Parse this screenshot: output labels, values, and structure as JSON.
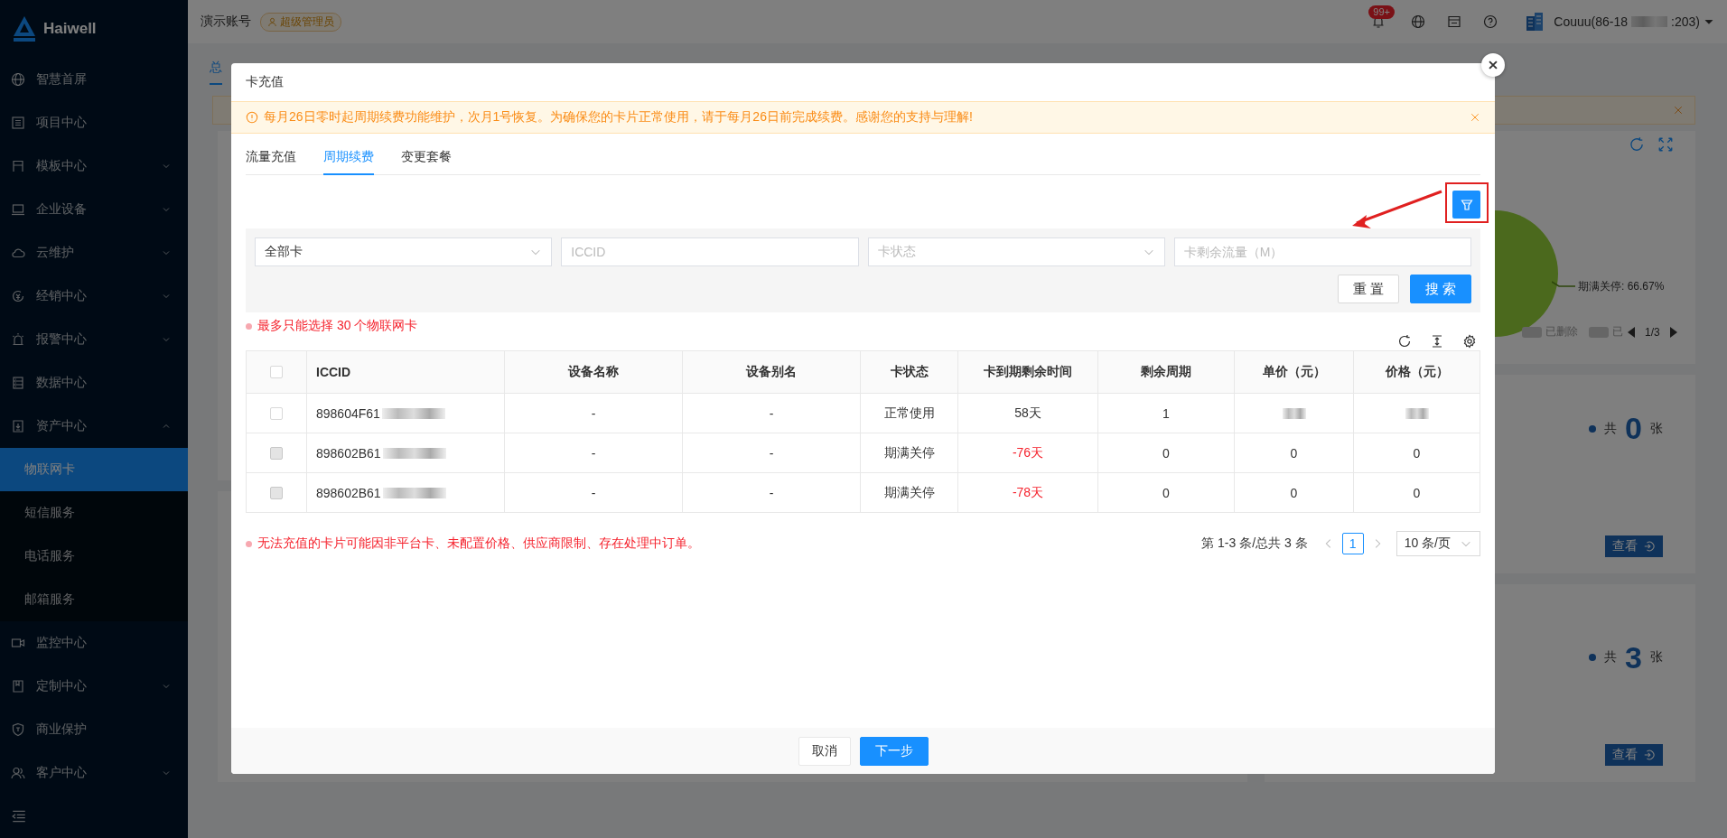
{
  "sidebar": {
    "brand": "Haiwell",
    "items": [
      {
        "label": "智慧首屏",
        "kind": "link"
      },
      {
        "label": "项目中心",
        "kind": "link"
      },
      {
        "label": "模板中心",
        "kind": "group",
        "expanded": false
      },
      {
        "label": "企业设备",
        "kind": "group",
        "expanded": false
      },
      {
        "label": "云维护",
        "kind": "group",
        "expanded": false
      },
      {
        "label": "经销中心",
        "kind": "group",
        "expanded": false
      },
      {
        "label": "报警中心",
        "kind": "group",
        "expanded": false
      },
      {
        "label": "数据中心",
        "kind": "link"
      },
      {
        "label": "资产中心",
        "kind": "group",
        "expanded": true,
        "children": [
          {
            "label": "物联网卡",
            "selected": true
          },
          {
            "label": "短信服务",
            "selected": false
          },
          {
            "label": "电话服务",
            "selected": false
          },
          {
            "label": "邮箱服务",
            "selected": false
          }
        ]
      },
      {
        "label": "监控中心",
        "kind": "link"
      },
      {
        "label": "定制中心",
        "kind": "group",
        "expanded": false
      },
      {
        "label": "商业保护",
        "kind": "link"
      },
      {
        "label": "客户中心",
        "kind": "group",
        "expanded": false
      }
    ]
  },
  "header": {
    "account": "演示账号",
    "role": "超级管理员",
    "notification_count": "99+",
    "user": "Couuu(86-18",
    "user_tail": ":203)"
  },
  "background": {
    "tab": "总",
    "chart_label": "期满关停: 66.67%",
    "legend": [
      "已删除",
      "已"
    ],
    "legend_page": "1/3",
    "cards": [
      {
        "prefix": "共",
        "count": "0",
        "unit": "张",
        "action": "查看"
      },
      {
        "prefix": "共",
        "count": "3",
        "unit": "张",
        "action": "查看"
      }
    ]
  },
  "modal": {
    "title": "卡充值",
    "notice": "每月26日零时起周期续费功能维护，次月1号恢复。为确保您的卡片正常使用，请于每月26日前完成续费。感谢您的支持与理解!",
    "tabs": [
      {
        "label": "流量充值",
        "selected": false
      },
      {
        "label": "周期续费",
        "selected": true
      },
      {
        "label": "变更套餐",
        "selected": false
      }
    ],
    "filters": [
      {
        "kind": "select",
        "value": "全部卡"
      },
      {
        "kind": "input",
        "placeholder": "ICCID"
      },
      {
        "kind": "select",
        "placeholder": "卡状态"
      },
      {
        "kind": "input",
        "placeholder": "卡剩余流量（M）"
      }
    ],
    "reset": "重 置",
    "search": "搜 索",
    "limit_note": "最多只能选择 30 个物联网卡",
    "table": {
      "header_checked": false,
      "columns": [
        "ICCID",
        "设备名称",
        "设备别名",
        "卡状态",
        "卡到期剩余时间",
        "剩余周期",
        "单价（元）",
        "价格（元）"
      ],
      "rows": [
        {
          "checked": false,
          "disabled": false,
          "iccid": "898604F61",
          "iccid_masked": true,
          "device_name": "-",
          "alias": "-",
          "status": "正常使用",
          "remaining": "58天",
          "expired": false,
          "cycles": "1",
          "unit_price": null,
          "price": null
        },
        {
          "checked": false,
          "disabled": true,
          "iccid": "898602B61",
          "iccid_masked": true,
          "device_name": "-",
          "alias": "-",
          "status": "期满关停",
          "remaining": "-76天",
          "expired": true,
          "cycles": "0",
          "unit_price": "0",
          "price": "0"
        },
        {
          "checked": false,
          "disabled": true,
          "iccid": "898602B61",
          "iccid_masked": true,
          "device_name": "-",
          "alias": "-",
          "status": "期满关停",
          "remaining": "-78天",
          "expired": true,
          "cycles": "0",
          "unit_price": "0",
          "price": "0"
        }
      ]
    },
    "error_note": "无法充值的卡片可能因非平台卡、未配置价格、供应商限制、存在处理中订单。",
    "pagination": {
      "summary": "第 1-3 条/总共 3 条",
      "pages": [
        {
          "label": "1",
          "selected": true
        }
      ],
      "page_size": "10 条/页"
    },
    "cancel": "取消",
    "next": "下一步"
  }
}
